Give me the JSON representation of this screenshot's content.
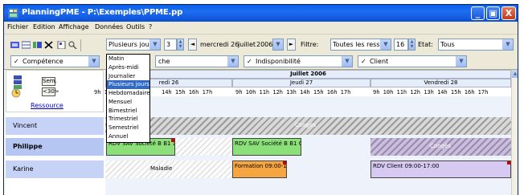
{
  "window": {
    "title": "PlanningPME - P:\\Exemples\\PPME.pp",
    "controls": {
      "minimize": "_",
      "maximize": "▣",
      "close": "X"
    }
  },
  "menu": [
    "Fichier",
    "Edition",
    "Affichage",
    "Données",
    "Outils",
    "?"
  ],
  "toolbar": {
    "view_select": "Plusieurs jours",
    "days_count": "3",
    "date_day": "mercredi 26",
    "date_month": "juillet",
    "date_year": "2006",
    "filter_label": "Filtre:",
    "resources_filter": "Toutes les ressources",
    "zoom_value": "16",
    "state_label": "Etat:",
    "state_value": "Tous",
    "prev": "◄",
    "next": "►"
  },
  "filters": {
    "competence": "Compétence",
    "tache": "che",
    "indisponibilite": "Indisponibilité",
    "client": "Client"
  },
  "view_options": [
    "Matin",
    "Après-midi",
    "Journalier",
    "Plusieurs jours",
    "Hebdomadaire",
    "Mensuel",
    "Bimestriel",
    "Trimestriel",
    "Semestriel",
    "Annuel"
  ],
  "view_options_selected_index": 3,
  "corner": {
    "sem_label": "Sem.",
    "nav_label": "<30>",
    "ressource_link": "Ressource"
  },
  "calendar": {
    "month": "Juillet 2006",
    "days": [
      "redi 26",
      "Jeudi 27",
      "Vendredi 28"
    ],
    "hours_day1": "9h 10",
    "hours_day1_rest": "14h 15h 16h 17h",
    "hours_day2": "9h 10h 11h 12h 13h 14h 15h 16h 17h",
    "hours_day3": "9h 10h 11h 12h 13h 14h 15h 16h 17h"
  },
  "resources": [
    {
      "name": "Vincent",
      "bold": false
    },
    {
      "name": "Philippe",
      "bold": true
    },
    {
      "name": "Karine",
      "bold": false
    }
  ],
  "events": {
    "vincent_conges": "Congés",
    "philippe_rdv1": "RDV SAV Société B  B1 1",
    "philippe_rdv2": "RDV SAV Société B  B1 C",
    "philippe_conges": "Congés",
    "karine_maladie": "Maladie",
    "karine_formation": "Formation 09:00-1",
    "karine_rdv_client": "RDV Client 09:00-17:00"
  },
  "colors": {
    "titlebar": "#0a5fe8",
    "appointment_green": "#8be07a",
    "appointment_orange": "#f5a640",
    "appointment_lilac": "#d6c9f2",
    "selection": "#316ac5"
  }
}
